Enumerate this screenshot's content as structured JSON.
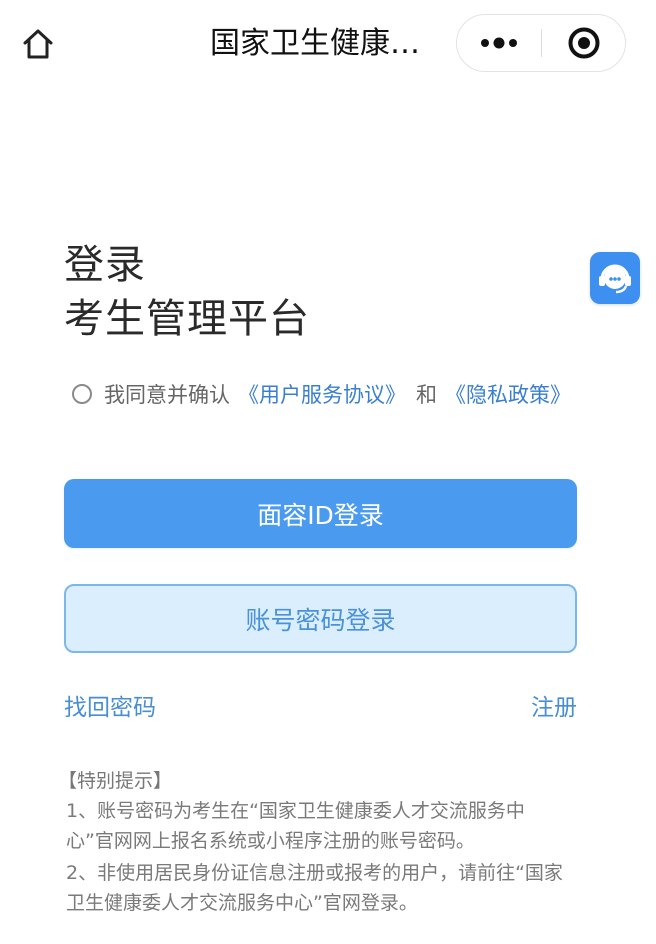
{
  "nav": {
    "title": "国家卫生健康…",
    "home_icon": "home-icon",
    "more_icon": "more-dots-icon",
    "close_icon": "target-close-icon"
  },
  "float_service": {
    "icon": "customer-service-icon",
    "color": "#3d8ff0"
  },
  "heading": {
    "line1": "登录",
    "line2": "考生管理平台"
  },
  "agreement": {
    "checked": false,
    "prefix": "我同意并确认",
    "user_agreement": "《用户服务协议》",
    "and": "和",
    "privacy_policy": "《隐私政策》"
  },
  "buttons": {
    "face_login": "面容ID登录",
    "password_login": "账号密码登录"
  },
  "links": {
    "retrieve_password": "找回密码",
    "register": "注册"
  },
  "notice": {
    "title": "【特别提示】",
    "items": [
      "1、账号密码为考生在“国家卫生健康委人才交流服务中心”官网网上报名系统或小程序注册的账号密码。",
      "2、非使用居民身份证信息注册或报考的用户，请前往“国家卫生健康委人才交流服务中心”官网登录。"
    ]
  },
  "colors": {
    "primary": "#4a9bef",
    "primary_light": "#dbeefd",
    "link": "#4a8ed2"
  }
}
